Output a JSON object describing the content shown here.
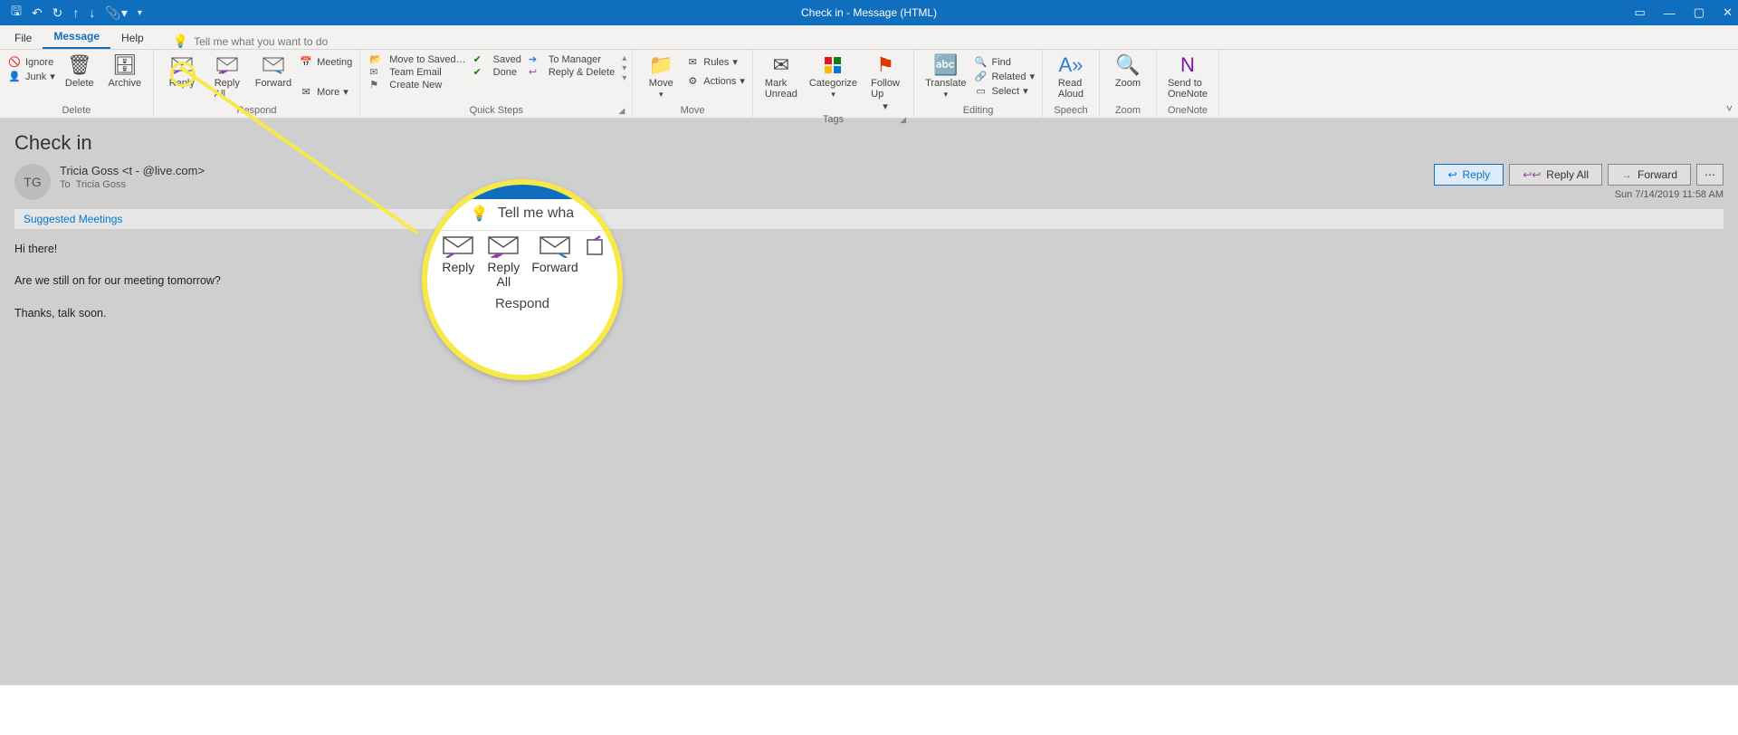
{
  "window": {
    "title": "Check in  -  Message (HTML)"
  },
  "qat": {
    "save": "save",
    "undo": "undo",
    "redo": "redo",
    "prev": "prev",
    "next": "next"
  },
  "menu": {
    "file": "File",
    "message": "Message",
    "help": "Help",
    "tellme": "Tell me what you want to do"
  },
  "ribbon": {
    "delete": {
      "ignore": "Ignore",
      "junk": "Junk",
      "delete": "Delete",
      "archive": "Archive",
      "label": "Delete"
    },
    "respond": {
      "reply": "Reply",
      "replyAll": "Reply\nAll",
      "forward": "Forward",
      "meeting": "Meeting",
      "more": "More",
      "label": "Respond"
    },
    "quickSteps": {
      "c1a": "Move to Saved…",
      "c1b": "Team Email",
      "c1c": "Create New",
      "c2a": "Saved",
      "c2b": "Done",
      "c3a": "To Manager",
      "c3b": "Reply & Delete",
      "label": "Quick Steps"
    },
    "move": {
      "move": "Move",
      "rules": "Rules",
      "actions": "Actions",
      "label": "Move"
    },
    "tags": {
      "markUnread": "Mark\nUnread",
      "categorize": "Categorize",
      "followUp": "Follow\nUp",
      "label": "Tags"
    },
    "editing": {
      "translate": "Translate",
      "find": "Find",
      "related": "Related",
      "select": "Select",
      "label": "Editing"
    },
    "speech": {
      "readAloud": "Read\nAloud",
      "label": "Speech"
    },
    "zoom": {
      "zoom": "Zoom",
      "label": "Zoom"
    },
    "onenote": {
      "send": "Send to\nOneNote",
      "label": "OneNote"
    }
  },
  "message": {
    "subject": "Check in",
    "avatar": "TG",
    "from": "Tricia Goss <t          -         @live.com>",
    "toLabel": "To",
    "to": "Tricia Goss",
    "date": "Sun 7/14/2019 11:58 AM",
    "suggested": "Suggested Meetings",
    "body1": "Hi there!",
    "body2": "Are we still on for our meeting tomorrow?",
    "body3": "Thanks, talk soon."
  },
  "hdrActions": {
    "reply": "Reply",
    "replyAll": "Reply All",
    "forward": "Forward"
  },
  "magnifier": {
    "tellme": "Tell me wha",
    "reply": "Reply",
    "replyAll": "Reply\nAll",
    "forward": "Forward",
    "label": "Respond"
  }
}
